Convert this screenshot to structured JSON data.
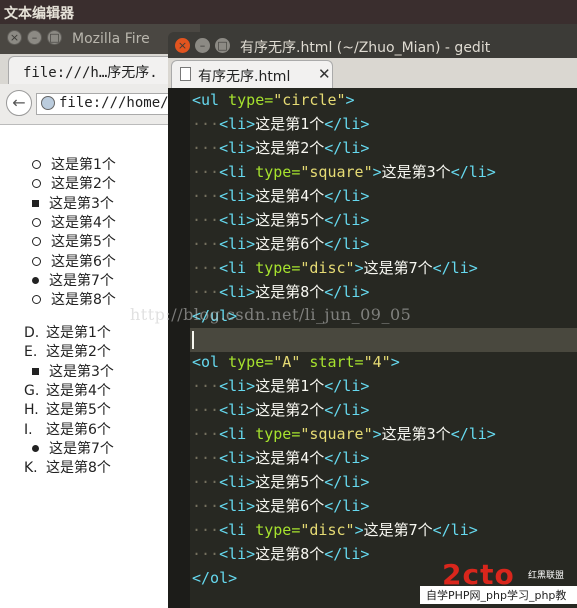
{
  "panel": {
    "title": "文本编辑器"
  },
  "firefox": {
    "window_title": "Mozilla Fire",
    "tab_label": "file:///h…序无序.",
    "url": "file:///home/l",
    "ul_items": [
      {
        "marker": "circle",
        "text": "这是第1个"
      },
      {
        "marker": "circle",
        "text": "这是第2个"
      },
      {
        "marker": "square",
        "text": "这是第3个"
      },
      {
        "marker": "circle",
        "text": "这是第4个"
      },
      {
        "marker": "circle",
        "text": "这是第5个"
      },
      {
        "marker": "circle",
        "text": "这是第6个"
      },
      {
        "marker": "disc",
        "text": "这是第7个"
      },
      {
        "marker": "circle",
        "text": "这是第8个"
      }
    ],
    "ol_items": [
      {
        "marker": "D.",
        "text": "这是第1个"
      },
      {
        "marker": "E.",
        "text": "这是第2个"
      },
      {
        "marker": "square",
        "text": "这是第3个"
      },
      {
        "marker": "G.",
        "text": "这是第4个"
      },
      {
        "marker": "H.",
        "text": "这是第5个"
      },
      {
        "marker": "I.",
        "text": "这是第6个"
      },
      {
        "marker": "disc",
        "text": "这是第7个"
      },
      {
        "marker": "K.",
        "text": "这是第8个"
      }
    ]
  },
  "gedit": {
    "window_title": "有序无序.html (~/Zhuo_Mian) - gedit",
    "tab_label": "有序无序.html",
    "code": {
      "ul_open": {
        "tag": "<ul",
        "attr": "type=",
        "val": "\"circle\"",
        "close": ">"
      },
      "ol_open": {
        "tag": "<ol",
        "attr": "type=",
        "val": "\"A\"",
        "attr2": "start=",
        "val2": "\"4\"",
        "close": ">"
      },
      "dots": "···",
      "li_open": "<li>",
      "li_close": "</li>",
      "li_typed_open": "<li",
      "type_attr": "type=",
      "gt": ">",
      "ul_close": "</ul>",
      "ol_close": "</ol>",
      "ul_lines": [
        {
          "text": "这是第1个"
        },
        {
          "text": "这是第2个"
        },
        {
          "type": "\"square\"",
          "text": "这是第3个"
        },
        {
          "text": "这是第4个"
        },
        {
          "text": "这是第5个"
        },
        {
          "text": "这是第6个"
        },
        {
          "type": "\"disc\"",
          "text": "这是第7个"
        },
        {
          "text": "这是第8个"
        }
      ],
      "ol_lines": [
        {
          "text": "这是第1个"
        },
        {
          "text": "这是第2个"
        },
        {
          "type": "\"square\"",
          "text": "这是第3个"
        },
        {
          "text": "这是第4个"
        },
        {
          "text": "这是第5个"
        },
        {
          "text": "这是第6个"
        },
        {
          "type": "\"disc\"",
          "text": "这是第7个"
        },
        {
          "text": "这是第8个"
        }
      ]
    }
  },
  "watermark": "http://blog.csdn.net/li_jun_09_05",
  "site_logo": {
    "big": "2cto",
    "small": "红黑联盟",
    "bar": "自学PHP网_php学习_php教"
  },
  "colors": {
    "tag": "#66d9ef",
    "attr": "#a6e22e",
    "string": "#e6db74",
    "text": "#f8f8f2",
    "bg": "#272822"
  }
}
